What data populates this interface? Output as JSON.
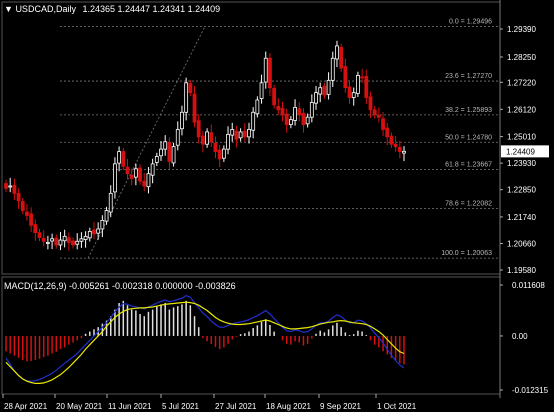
{
  "header": {
    "symbol": "USDCAD,Daily",
    "ohlc": "1.24365 1.24447 1.24341 1.24409"
  },
  "macd_header": {
    "label": "MACD(12,26,9) -0.005261 -0.002318 0.000000 -0.003826"
  },
  "current_price": "1.24409",
  "price_axis": [
    "1.29390",
    "1.28250",
    "1.27220",
    "1.26120",
    "1.25010",
    "1.23930",
    "1.22850",
    "1.21740",
    "1.20660",
    "1.19580"
  ],
  "macd_axis": [
    "0.011608",
    "0.00",
    "-0.012315"
  ],
  "time_axis": [
    "28 Apr 2021",
    "20 May 2021",
    "11 Jun 2021",
    "5 Jul 2021",
    "27 Jul 2021",
    "18 Aug 2021",
    "9 Sep 2021",
    "1 Oct 2021"
  ],
  "colors": {
    "bull": "#ffffff",
    "bear": "#d41010",
    "signal": "#e8e800",
    "macd_line": "#2030d0",
    "grid": "#7a7a7a"
  },
  "chart_data": {
    "type": "candlestick",
    "symbol": "USDCAD",
    "timeframe": "Daily",
    "fibonacci": [
      {
        "level": "0.0",
        "price": 1.29496,
        "label": "0.0 = 1.29496"
      },
      {
        "level": "23.6",
        "price": 1.2727,
        "label": "23.6 = 1.27270"
      },
      {
        "level": "38.2",
        "price": 1.25893,
        "label": "38.2 = 1.25893"
      },
      {
        "level": "50.0",
        "price": 1.2478,
        "label": "50.0 = 1.24780"
      },
      {
        "level": "61.8",
        "price": 1.23667,
        "label": "61.8 = 1.23667"
      },
      {
        "level": "78.6",
        "price": 1.22082,
        "label": "78.6 = 1.22082"
      },
      {
        "level": "100.0",
        "price": 1.20063,
        "label": "100.0 = 1.20063"
      }
    ],
    "price_range": [
      1.1958,
      1.2939
    ],
    "macd_range": [
      -0.012315,
      0.011608
    ],
    "closes": [
      1.229,
      1.23,
      1.227,
      1.224,
      1.22,
      1.218,
      1.214,
      1.211,
      1.209,
      1.2075,
      1.207,
      1.2085,
      1.206,
      1.208,
      1.2095,
      1.207,
      1.206,
      1.2075,
      1.2085,
      1.2095,
      1.2115,
      1.2105,
      1.2125,
      1.216,
      1.22,
      1.227,
      1.239,
      1.244,
      1.238,
      1.235,
      1.233,
      1.237,
      1.232,
      1.23,
      1.235,
      1.239,
      1.242,
      1.245,
      1.248,
      1.24,
      1.246,
      1.253,
      1.26,
      1.272,
      1.268,
      1.256,
      1.25,
      1.247,
      1.252,
      1.248,
      1.244,
      1.241,
      1.245,
      1.251,
      1.253,
      1.249,
      1.252,
      1.25,
      1.253,
      1.26,
      1.265,
      1.272,
      1.282,
      1.27,
      1.263,
      1.261,
      1.259,
      1.255,
      1.257,
      1.262,
      1.259,
      1.255,
      1.258,
      1.264,
      1.268,
      1.27,
      1.267,
      1.273,
      1.282,
      1.287,
      1.278,
      1.27,
      1.266,
      1.268,
      1.275,
      1.274,
      1.266,
      1.261,
      1.259,
      1.258,
      1.253,
      1.25,
      1.247,
      1.246,
      1.244,
      1.2441
    ],
    "macd_hist": [
      -0.0035,
      -0.004,
      -0.0045,
      -0.005,
      -0.0055,
      -0.0058,
      -0.0057,
      -0.0055,
      -0.0052,
      -0.0048,
      -0.0045,
      -0.004,
      -0.0036,
      -0.003,
      -0.0026,
      -0.002,
      -0.0015,
      -0.001,
      -0.0005,
      0.0005,
      0.001,
      0.0015,
      0.002,
      0.0028,
      0.0035,
      0.0045,
      0.006,
      0.0075,
      0.008,
      0.007,
      0.006,
      0.0058,
      0.005,
      0.0045,
      0.0055,
      0.006,
      0.0068,
      0.0072,
      0.0075,
      0.006,
      0.0065,
      0.0068,
      0.0072,
      0.008,
      0.007,
      0.0045,
      0.002,
      -0.0005,
      -0.0012,
      -0.0018,
      -0.0025,
      -0.003,
      -0.0026,
      -0.0018,
      -0.0008,
      -0.0002,
      0.0004,
      0.0006,
      0.001,
      0.0018,
      0.0024,
      0.0032,
      0.0038,
      0.0025,
      0.001,
      0.0,
      -0.001,
      -0.0018,
      -0.002,
      -0.0012,
      -0.0015,
      -0.0022,
      -0.0018,
      -0.0006,
      0.0005,
      0.0012,
      0.0008,
      0.0015,
      0.0024,
      0.003,
      0.002,
      0.0008,
      0.0002,
      0.0004,
      0.0012,
      0.001,
      0.0002,
      -0.001,
      -0.002,
      -0.0026,
      -0.0035,
      -0.0042,
      -0.005,
      -0.0055,
      -0.0062,
      -0.0065
    ],
    "macd_signal": [
      -0.006,
      -0.007,
      -0.008,
      -0.009,
      -0.0098,
      -0.0103,
      -0.0106,
      -0.0108,
      -0.0108,
      -0.0107,
      -0.0104,
      -0.01,
      -0.0094,
      -0.0088,
      -0.008,
      -0.0072,
      -0.0062,
      -0.0052,
      -0.0042,
      -0.003,
      -0.002,
      -0.001,
      0.0,
      0.001,
      0.0022,
      0.0032,
      0.0042,
      0.005,
      0.0056,
      0.006,
      0.0062,
      0.0063,
      0.0064,
      0.0064,
      0.0065,
      0.0066,
      0.0068,
      0.007,
      0.0072,
      0.0073,
      0.0074,
      0.0075,
      0.0076,
      0.0077,
      0.0076,
      0.0074,
      0.007,
      0.0064,
      0.0058,
      0.005,
      0.0042,
      0.0036,
      0.0032,
      0.0029,
      0.0027,
      0.0026,
      0.0026,
      0.0027,
      0.0028,
      0.003,
      0.0032,
      0.0034,
      0.0036,
      0.0034,
      0.003,
      0.0026,
      0.0022,
      0.0018,
      0.0016,
      0.0016,
      0.0017,
      0.0018,
      0.0019,
      0.0021,
      0.0024,
      0.0027,
      0.0029,
      0.0031,
      0.0032,
      0.0034,
      0.0035,
      0.0034,
      0.0032,
      0.003,
      0.0029,
      0.0028,
      0.0026,
      0.0022,
      0.0016,
      0.001,
      0.0002,
      -0.0008,
      -0.0018,
      -0.0028,
      -0.0036,
      -0.004
    ],
    "macd_main": [
      -0.005,
      -0.0065,
      -0.008,
      -0.009,
      -0.0098,
      -0.0102,
      -0.0103,
      -0.0102,
      -0.0099,
      -0.0095,
      -0.009,
      -0.0085,
      -0.0078,
      -0.007,
      -0.0062,
      -0.0055,
      -0.0048,
      -0.004,
      -0.003,
      -0.002,
      -0.001,
      0.0,
      0.001,
      0.002,
      0.003,
      0.0042,
      0.0055,
      0.0066,
      0.0074,
      0.0072,
      0.0068,
      0.0066,
      0.0064,
      0.0062,
      0.0066,
      0.007,
      0.0075,
      0.0079,
      0.0082,
      0.0078,
      0.008,
      0.0083,
      0.0086,
      0.0092,
      0.0088,
      0.0076,
      0.0064,
      0.0052,
      0.0044,
      0.0034,
      0.0026,
      0.002,
      0.002,
      0.0024,
      0.0028,
      0.003,
      0.0032,
      0.0034,
      0.0037,
      0.0042,
      0.0046,
      0.0052,
      0.0058,
      0.005,
      0.004,
      0.003,
      0.002,
      0.0012,
      0.001,
      0.0014,
      0.0012,
      0.0008,
      0.001,
      0.0016,
      0.0024,
      0.003,
      0.003,
      0.0034,
      0.0042,
      0.0048,
      0.0044,
      0.0036,
      0.003,
      0.003,
      0.0036,
      0.0034,
      0.0028,
      0.0018,
      0.0006,
      -0.0004,
      -0.0016,
      -0.003,
      -0.0044,
      -0.0056,
      -0.0066,
      -0.0073
    ]
  }
}
